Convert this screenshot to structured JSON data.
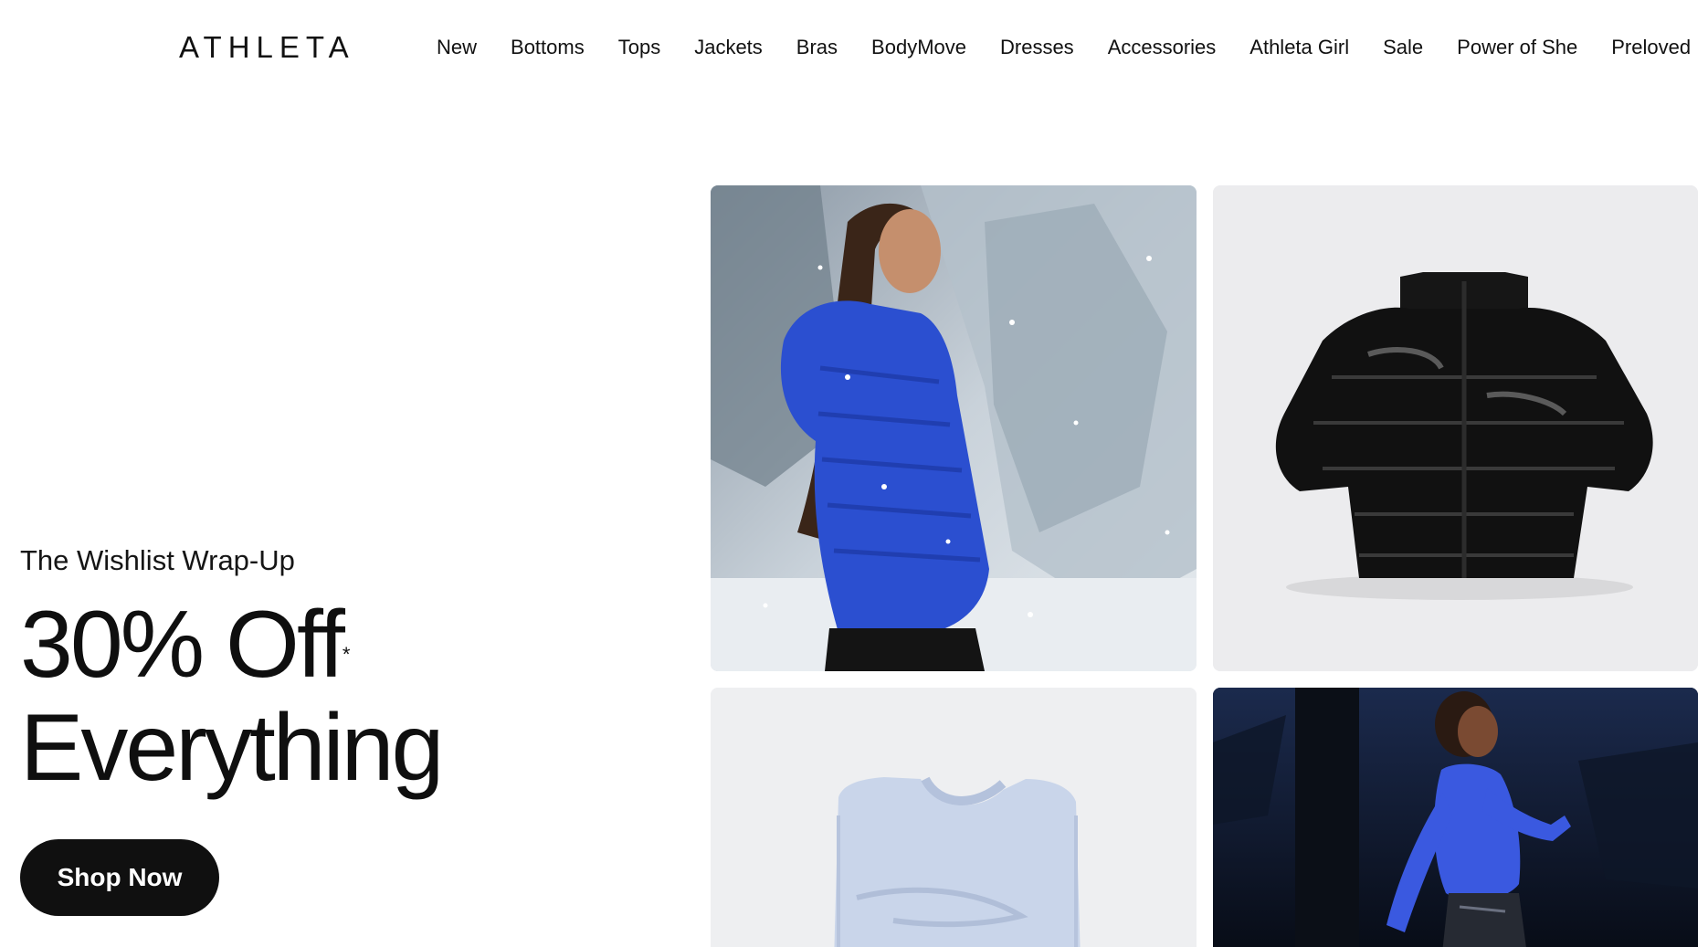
{
  "header": {
    "logo": "ATHLETA",
    "nav": [
      "New",
      "Bottoms",
      "Tops",
      "Jackets",
      "Bras",
      "BodyMove",
      "Dresses",
      "Accessories",
      "Athleta Girl",
      "Sale",
      "Power of She",
      "Preloved"
    ]
  },
  "hero": {
    "eyebrow": "The Wishlist Wrap-Up",
    "headline_line1": "30% Off",
    "headline_asterisk": "*",
    "headline_line2": "Everything",
    "cta_label": "Shop Now"
  },
  "tiles": [
    {
      "name": "woman-blue-puffer-snow",
      "icon": "lifestyle-photo"
    },
    {
      "name": "black-puffer-jacket",
      "icon": "product-photo"
    },
    {
      "name": "light-blue-sweatshirt",
      "icon": "product-photo"
    },
    {
      "name": "woman-blue-top-running",
      "icon": "lifestyle-photo"
    }
  ],
  "colors": {
    "text": "#111111",
    "cta_bg": "#101010",
    "cta_text": "#ffffff",
    "tile_grey": "#ececee",
    "jacket_blue": "#2b4fd0"
  }
}
